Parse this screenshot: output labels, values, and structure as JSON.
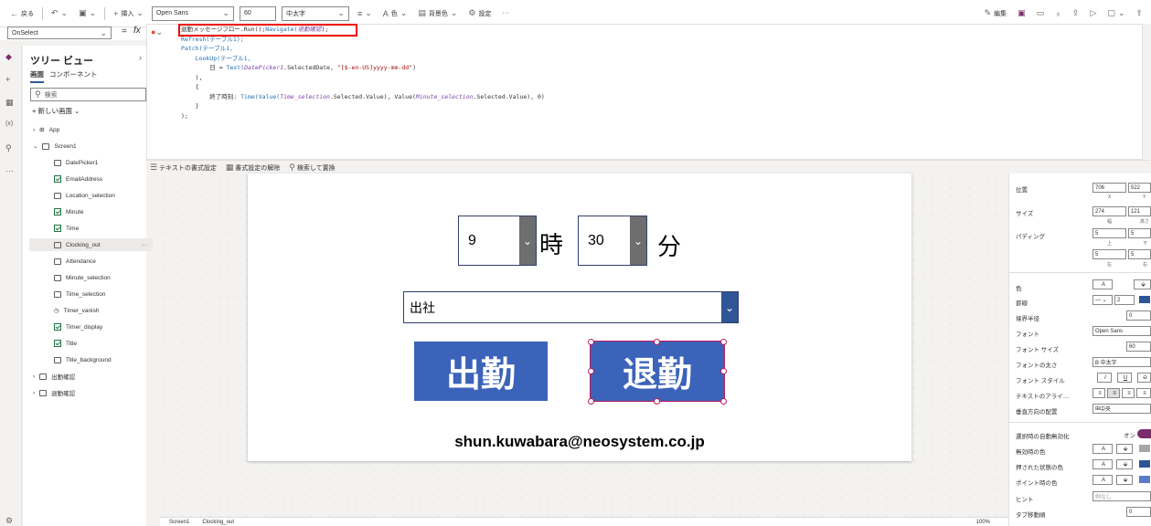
{
  "toolbar": {
    "back": "戻る",
    "insert": "挿入",
    "font": "Open Sans",
    "font_size": "60",
    "font_weight": "中太字",
    "color": "色",
    "bg_color": "背景色",
    "settings": "設定",
    "more": "···",
    "edit": "編集"
  },
  "formula": {
    "property": "OnSelect",
    "eq": "=",
    "fx": "fx"
  },
  "code": {
    "line1_a": "退勤メッセージフロー",
    "line1_b": ".Run();",
    "line1_c": "Navigate(",
    "line1_d": "退勤確認",
    "line1_e": ");",
    "line2": "Refresh(テーブル1);",
    "line3": "Patch(テーブル1,",
    "line4": "    LookUp(テーブル1,",
    "line5_a": "        日 = ",
    "line5_b": "Text(",
    "line5_c": "DatePicker1",
    "line5_d": ".SelectedDate, ",
    "line5_e": "\"[$-en-US]yyyy-mm-dd\"",
    "line5_f": ")",
    "line6": "    ),",
    "line7": "    {",
    "line8_a": "        終了時刻: ",
    "line8_b": "Time(Value(",
    "line8_c": "Time_selection",
    "line8_d": ".Selected.Value), Value(",
    "line8_e": "Minute_selection",
    "line8_f": ".Selected.Value), 0)",
    "line9": "    }",
    "line10": ");"
  },
  "editor_bottom": {
    "format_text": "テキストの書式設定",
    "remove_format": "書式設定の解除",
    "find_replace": "検索して置換"
  },
  "tree": {
    "title": "ツリー ビュー",
    "tab_screen": "画面",
    "tab_component": "コンポーネント",
    "search_placeholder": "検索",
    "new_screen": "新しい画面",
    "items": [
      {
        "label": "App"
      },
      {
        "label": "Screen1"
      },
      {
        "label": "DatePicker1"
      },
      {
        "label": "EmailAddress"
      },
      {
        "label": "Location_selection"
      },
      {
        "label": "Minute"
      },
      {
        "label": "Time"
      },
      {
        "label": "Clocking_out"
      },
      {
        "label": "Attendance"
      },
      {
        "label": "Minute_selection"
      },
      {
        "label": "Time_selection"
      },
      {
        "label": "Timer_vanish"
      },
      {
        "label": "Timer_display"
      },
      {
        "label": "Title"
      },
      {
        "label": "Title_background"
      },
      {
        "label": "出勤確認"
      },
      {
        "label": "退勤確認"
      }
    ],
    "item_more": "···"
  },
  "app": {
    "hour_value": "9",
    "hour_unit": "時",
    "minute_value": "30",
    "minute_unit": "分",
    "location_value": "出社",
    "clock_in": "出勤",
    "clock_out": "退勤",
    "email": "shun.kuwabara@neosystem.co.jp"
  },
  "statusbar": {
    "screen": "Screen1",
    "control": "Clocking_out",
    "zoom": "100%"
  },
  "props": {
    "position": "位置",
    "x": "706",
    "y": "522",
    "x_label": "X",
    "y_label": "Y",
    "size": "サイズ",
    "width": "274",
    "height": "121",
    "width_label": "幅",
    "height_label": "高さ",
    "padding": "パディング",
    "pad_top": "5",
    "pad_bottom": "5",
    "pad_left": "5",
    "pad_right": "5",
    "pad_top_label": "上",
    "pad_bottom_label": "下",
    "pad_left_label": "左",
    "pad_right_label": "右",
    "color": "色",
    "border": "罫線",
    "border_width": "2",
    "radius": "境界半径",
    "radius_value": "0",
    "font": "フォント",
    "font_value": "Open Sans",
    "font_size": "フォント サイズ",
    "font_size_value": "60",
    "font_weight": "フォントの太さ",
    "font_weight_value": "B 中太字",
    "font_style": "フォント スタイル",
    "text_align": "テキストのアライ…",
    "vertical_align": "垂直方向の配置",
    "vertical_align_value": "中央",
    "auto_disable": "選択時の自動無効化",
    "toggle_label": "オン",
    "disabled_color": "無効時の色",
    "pressed_color": "押された状態の色",
    "hover_color": "ポイント時の色",
    "hint": "ヒント",
    "hint_placeholder": "例なし",
    "tab_index": "タブ移動順",
    "tab_index_value": "0"
  }
}
